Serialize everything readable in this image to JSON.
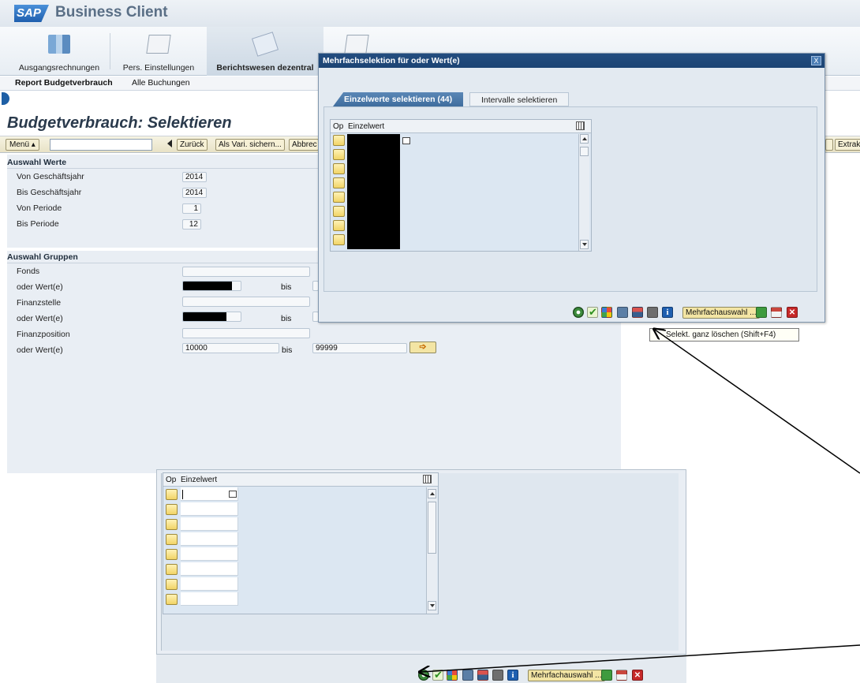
{
  "app": {
    "logo": "SAP",
    "title": "Business Client"
  },
  "launchpad": [
    {
      "label": "Ausgangsrechnungen",
      "icon": "building-icon"
    },
    {
      "label": "Pers. Einstellungen",
      "icon": "folder-icon"
    },
    {
      "label": "Berichtswesen dezentral",
      "icon": "documents-icon",
      "active": true
    },
    {
      "label": "",
      "icon": "folder-icon"
    }
  ],
  "subtabs": [
    "Report Budgetverbrauch",
    "Alle Buchungen"
  ],
  "page": {
    "title": "Budgetverbrauch: Selektieren"
  },
  "toolbar": {
    "menu": "Menü ▴",
    "buttons": [
      "Zurück",
      "Als Vari. sichern...",
      "Abbrec",
      "Extrak"
    ]
  },
  "section_werte": {
    "title": "Auswahl Werte",
    "fields": [
      {
        "label": "Von Geschäftsjahr",
        "value": "2014"
      },
      {
        "label": "Bis Geschäftsjahr",
        "value": "2014"
      },
      {
        "label": "Von Periode",
        "value": "1"
      },
      {
        "label": "Bis Periode",
        "value": "12"
      }
    ]
  },
  "section_gruppen": {
    "title": "Auswahl Gruppen",
    "fonds_label": "Fonds",
    "oder_label": "oder Wert(e)",
    "bis": "bis",
    "finanzstelle_label": "Finanzstelle",
    "finanzposition_label": "Finanzposition",
    "fp_from": "10000",
    "fp_to": "99999"
  },
  "dialog": {
    "title": "Mehrfachselektion für oder Wert(e)",
    "close": "X",
    "tab_single": "Einzelwerte selektieren (44)",
    "tab_interval": "Intervalle selektieren",
    "col_op": "Op",
    "col_value": "Einzelwert",
    "multi_button": "Mehrfachauswahl ...",
    "tooltip": "Selekt. ganz löschen (Shift+F4)"
  },
  "zoom": {
    "col_op": "Op",
    "col_value": "Einzelwert",
    "multi_button": "Mehrfachauswahl ..."
  },
  "colors": {
    "accent": "#1c4474",
    "button_yellow": "#f3e5a4",
    "form_bg": "#e9eef4"
  }
}
